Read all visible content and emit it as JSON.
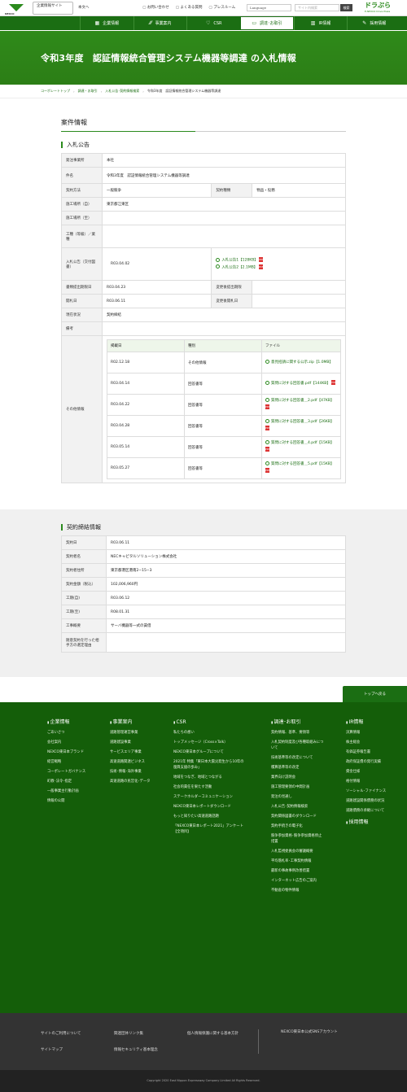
{
  "header": {
    "logo": "NEXCO",
    "site_tag": "企業情報サイト",
    "links": "本文へ",
    "util": [
      "お問い合わせ",
      "よくある質問",
      "プレスルーム"
    ],
    "lang": "Language",
    "search_placeholder": "サイト内検索",
    "search_btn": "検索",
    "drapura": "ドラぷら",
    "drapura_sub": "E-NEXCO Drive Plaza"
  },
  "nav": [
    {
      "label": "企業情報",
      "icon": "▦"
    },
    {
      "label": "事業案内",
      "icon": "⁄⁄⁄"
    },
    {
      "label": "CSR",
      "icon": "♡"
    },
    {
      "label": "調達･お取引",
      "icon": "▭"
    },
    {
      "label": "IR情報",
      "icon": "▥"
    },
    {
      "label": "採用情報",
      "icon": "✎"
    }
  ],
  "hero": {
    "title": "令和3年度　認証情報統合管理システム機器等調達 の入札情報"
  },
  "breadcrumb": [
    "コーポレートトップ",
    "調達・お取引",
    "入札公告･契約情報検索",
    "令和3年度　認証情報統合管理システム機器等調達"
  ],
  "section1": {
    "title": "案件情報",
    "sub": "入札公告",
    "rows": {
      "office_h": "発注事業所",
      "office_v": "本社",
      "name_h": "件名",
      "name_v": "令和3年度　認証情報統合管理システム機器等調達",
      "method_h": "契約方法",
      "method_v": "一般競争",
      "type_h": "契約種類",
      "type_v": "物品・役務",
      "place_from_h": "施工場所（自）",
      "place_from_v": "東京都江東区",
      "place_to_h": "施工場所（至）",
      "kind_h": "工種（等級）／業種",
      "notice_h": "入札公告（交付図書）",
      "notice_v": "R03.04.02",
      "notice_files": [
        "入札公告1【128KB】",
        "入札公告2【2.1MB】"
      ],
      "submit_h": "書類提出期限日",
      "submit_v": "R03.04.23",
      "submit_change_h": "変更後提出期限",
      "open_h": "開札日",
      "open_v": "R03.06.11",
      "open_change_h": "変更後開札日",
      "status_h": "現在状況",
      "status_v": "契約締結",
      "note_h": "備考",
      "other_h": "その他情報"
    },
    "other": {
      "headers": [
        "掲載日",
        "種別",
        "ファイル"
      ],
      "rows": [
        {
          "date": "R02.12.18",
          "kind": "その他情報",
          "file": "意見招請に関する公示.zip【1.0MB】"
        },
        {
          "date": "R03.04.14",
          "kind": "回答書等",
          "file": "質問に対する回答書.pdf【144KB】"
        },
        {
          "date": "R03.04.22",
          "kind": "回答書等",
          "file": "質問に対する回答書＿2.pdf【47KB】"
        },
        {
          "date": "R03.04.28",
          "kind": "回答書等",
          "file": "質問に対する回答書＿3.pdf【26KB】"
        },
        {
          "date": "R03.05.14",
          "kind": "回答書等",
          "file": "質問に対する回答書＿4.pdf【15KB】"
        },
        {
          "date": "R03.05.27",
          "kind": "回答書等",
          "file": "質問に対する回答書＿5.pdf【15KB】"
        }
      ]
    }
  },
  "section2": {
    "title": "契約締結情報",
    "rows": [
      {
        "h": "契約日",
        "v": "R03.06.11"
      },
      {
        "h": "契約者名",
        "v": "NECキャピタルソリューション株式会社"
      },
      {
        "h": "契約者住所",
        "v": "東京都港区港南2−15−3"
      },
      {
        "h": "契約金額（税込）",
        "v": "102,006,960円"
      },
      {
        "h": "工期(自)",
        "v": "R03.06.12"
      },
      {
        "h": "工期(至)",
        "v": "R08.01.31"
      },
      {
        "h": "工事概要",
        "v": "サーバ機器等一式の賃借"
      },
      {
        "h": "随意契約を行った相手方の選定理由",
        "v": ""
      }
    ]
  },
  "totop": "トップへ戻る",
  "footer": {
    "cols": [
      {
        "title": "企業情報",
        "items": [
          "ごあいさつ",
          "会社案内",
          "NEXCO東日本ブランド",
          "経営戦略",
          "コーポレートガバナンス",
          "町教･法令･指定",
          "一般事業主行動計画",
          "情報の公開"
        ]
      },
      {
        "title": "事業案内",
        "items": [
          "道路管理運営事業",
          "道路建設事業",
          "サービスエリア事業",
          "高速道路関連ビジネス",
          "技術･情報･海外事業",
          "高速道路の民営化･データ"
        ]
      },
      {
        "title": "CSR",
        "items": [
          "私たちの想い",
          "トップメッセージ（Cross×Talk）",
          "NEXCO東日本グループについて",
          "2021年 特集「東日本大震災発生から10年の復興支援の歩み」",
          "地域をつなぎ、地域とつながる",
          "社会的責任を果たす活動",
          "ステークホルダーコミュニケーション",
          "NEXCO東日本レポートダウンロード",
          "もっと知りたい高速道路話題",
          "「NEXCO東日本レポート2021」アンケート【全項目】"
        ]
      },
      {
        "title": "調達･お取引",
        "items": [
          "契約情報、基準、要領等",
          "入札契約制度及び各種取組みについて",
          "技術基準等の改定について",
          "積算基準等の改定",
          "業界向け説明会",
          "施工管理要領の中間計画",
          "発注の見通し",
          "入札公告･契約情報検索",
          "契約関係図書のダウンロード",
          "契約手続きの電子化",
          "競争参加資格･競争参加資格停止措置",
          "入札監視委員会の審議概要",
          "平均落札率･工事契約情報",
          "最新の事故事例改善措置",
          "インターネット広告のご案内",
          "不動産の物件情報"
        ]
      },
      {
        "title": "IR情報",
        "items": [
          "決算情報",
          "株主総会",
          "有価証券報告書",
          "政府保証債の発行実績",
          "資金仕様",
          "格付情報",
          "ソーシャル･ファイナンス",
          "道路建設関係債務の状況",
          "道路債務の承継について"
        ]
      },
      {
        "title": "採用情報",
        "items": []
      }
    ],
    "bottom": [
      "サイトのご利用について",
      "関連団体リンク集",
      "個人情報保護に関する基本方針",
      "サイトマップ",
      "情報セキュリティ基本理念",
      "NEXCO東日本公式SNSアカウント"
    ],
    "copyright": "Copyright 2020 East Nippon Expressway Company Limited All Rights Reserved."
  },
  "colors": {
    "primary": "#1b6e13",
    "hero": "#2f8a1a"
  }
}
